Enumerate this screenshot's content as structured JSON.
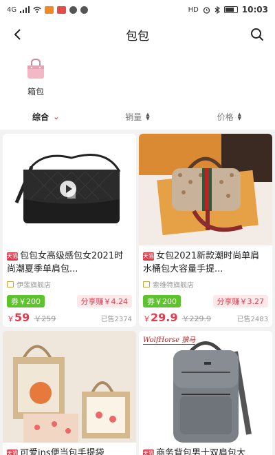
{
  "status_bar": {
    "left_text": "4G",
    "time": "10:03",
    "hd": "HD"
  },
  "nav": {
    "title": "包包"
  },
  "category": {
    "label": "箱包"
  },
  "sort": {
    "tabs": [
      {
        "label": "综合"
      },
      {
        "label": "销量"
      },
      {
        "label": "价格"
      }
    ]
  },
  "products": [
    {
      "badge": "天猫",
      "title": "包包女高级感包女2021时尚潮夏季单肩包...",
      "shop": "伊莲旗舰店",
      "coupon": "券￥200",
      "share": "分享赚￥4.24",
      "price_symbol": "￥",
      "price": "59",
      "old_price": "￥259",
      "sold": "已售2374"
    },
    {
      "badge": "天猫",
      "title": "女包2021新款潮时尚单肩水桶包大容量手提...",
      "shop": "索维特旗舰店",
      "coupon": "券￥200",
      "share": "分享赚￥3.27",
      "price_symbol": "￥",
      "price": "29.9",
      "old_price": "￥229.9",
      "sold": "已售2483"
    },
    {
      "badge": "天猫",
      "title": "可爱ins便当包手提袋"
    },
    {
      "badge": "天猫",
      "title": "商务背包男士双肩包大",
      "image_brand": "WolfHorse 狼马"
    }
  ],
  "colors": {
    "accent": "#e5394b",
    "coupon_green": "#5cc32c",
    "share_bg": "#fde8ea",
    "background": "#f2f2f2"
  }
}
